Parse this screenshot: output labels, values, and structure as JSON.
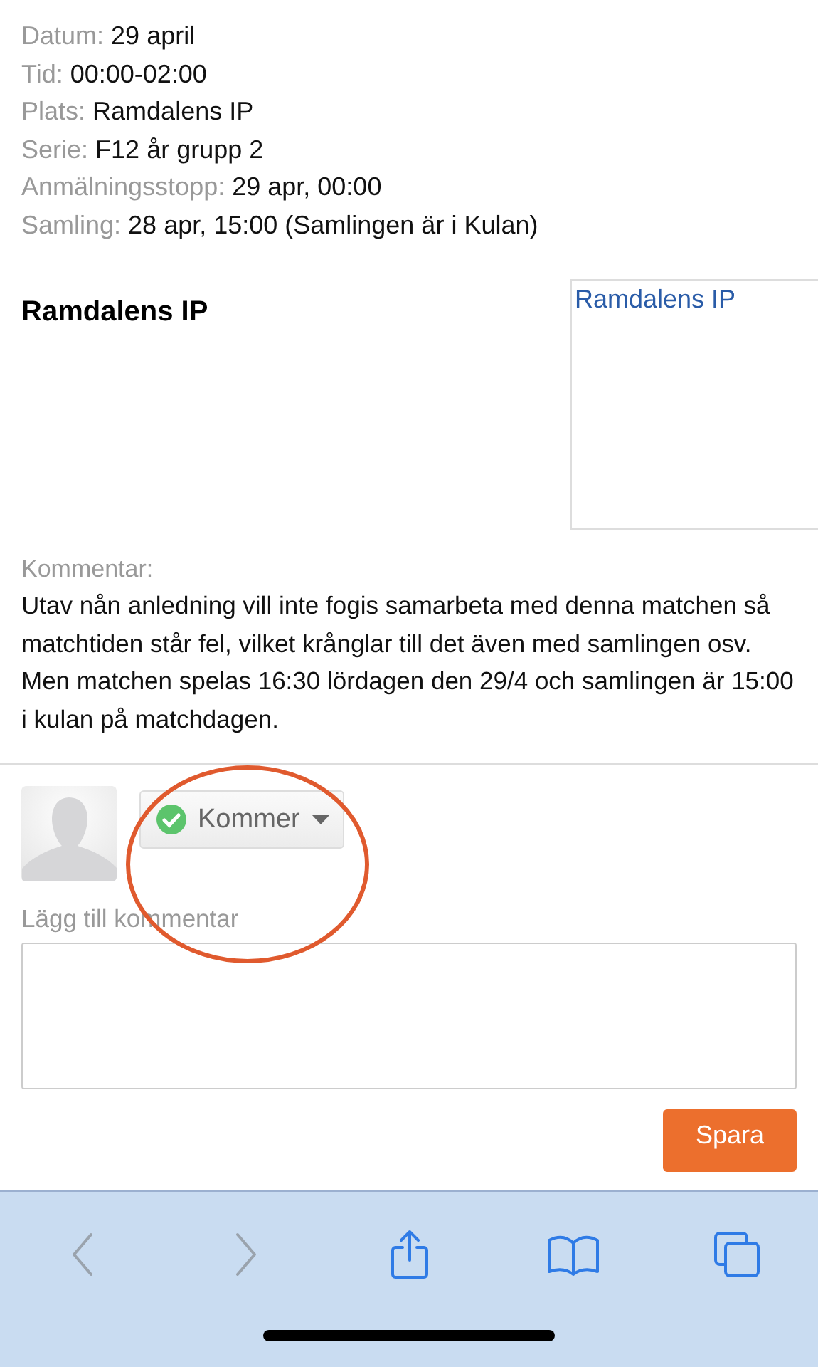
{
  "details": [
    {
      "label": "Datum:",
      "value": "29 april"
    },
    {
      "label": "Tid:",
      "value": "00:00-02:00"
    },
    {
      "label": "Plats:",
      "value": "Ramdalens IP"
    },
    {
      "label": "Serie:",
      "value": "F12 år grupp 2"
    },
    {
      "label": "Anmälningsstopp:",
      "value": "29 apr, 00:00"
    },
    {
      "label": "Samling:",
      "value": "28 apr, 15:00 (Samlingen är i Kulan)"
    }
  ],
  "venue": {
    "title": "Ramdalens IP",
    "map_link": "Ramdalens IP"
  },
  "comment": {
    "label": "Kommentar:",
    "paragraphs": [
      "Utav nån anledning vill inte fogis samarbeta med denna matchen så matchtiden står fel, vilket krånglar till det även med samlingen osv.",
      "Men matchen spelas 16:30 lördagen den 29/4 och samlingen är 15:00 i kulan på matchdagen."
    ]
  },
  "rsvp": {
    "status": "Kommer",
    "kind": "yes"
  },
  "new_comment": {
    "label": "Lägg till kommentar",
    "button": "Spara"
  },
  "toolbar": [
    {
      "kind": "back",
      "disabled": true
    },
    {
      "kind": "forward",
      "disabled": true
    },
    {
      "kind": "share",
      "disabled": false
    },
    {
      "kind": "bookmarks",
      "disabled": false
    },
    {
      "kind": "tabs",
      "disabled": false
    }
  ]
}
